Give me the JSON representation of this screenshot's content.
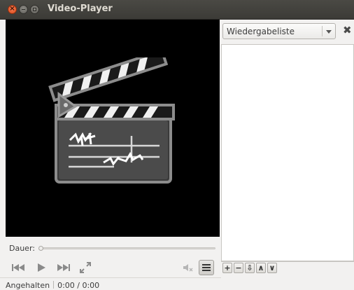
{
  "window": {
    "title": "Video-Player",
    "buttons": {
      "close": "close-icon",
      "minimize": "minimize-icon",
      "maximize": "maximize-icon"
    }
  },
  "video": {
    "placeholder_icon": "clapperboard-icon"
  },
  "duration": {
    "label": "Dauer:",
    "progress": 0
  },
  "controls": {
    "prev": "skip-back-icon",
    "play": "play-icon",
    "next": "skip-forward-icon",
    "fullscreen": "fullscreen-icon",
    "volume": "volume-muted-icon",
    "playlist_toggle": "list-icon"
  },
  "status": {
    "state": "Angehalten",
    "time": "0:00 / 0:00"
  },
  "sidebar": {
    "combo_value": "Wiedergabeliste",
    "close_icon": "close-icon",
    "toolbar": [
      {
        "glyph": "+",
        "icon": "add-icon"
      },
      {
        "glyph": "−",
        "icon": "remove-icon"
      },
      {
        "glyph": "⇩",
        "icon": "save-icon"
      },
      {
        "glyph": "∧",
        "icon": "move-up-icon"
      },
      {
        "glyph": "∨",
        "icon": "move-down-icon"
      }
    ]
  },
  "colors": {
    "titlebar": "#3c3b37",
    "close_button": "#df4b1a",
    "video_bg": "#000000",
    "window_bg": "#f2f1f0"
  }
}
